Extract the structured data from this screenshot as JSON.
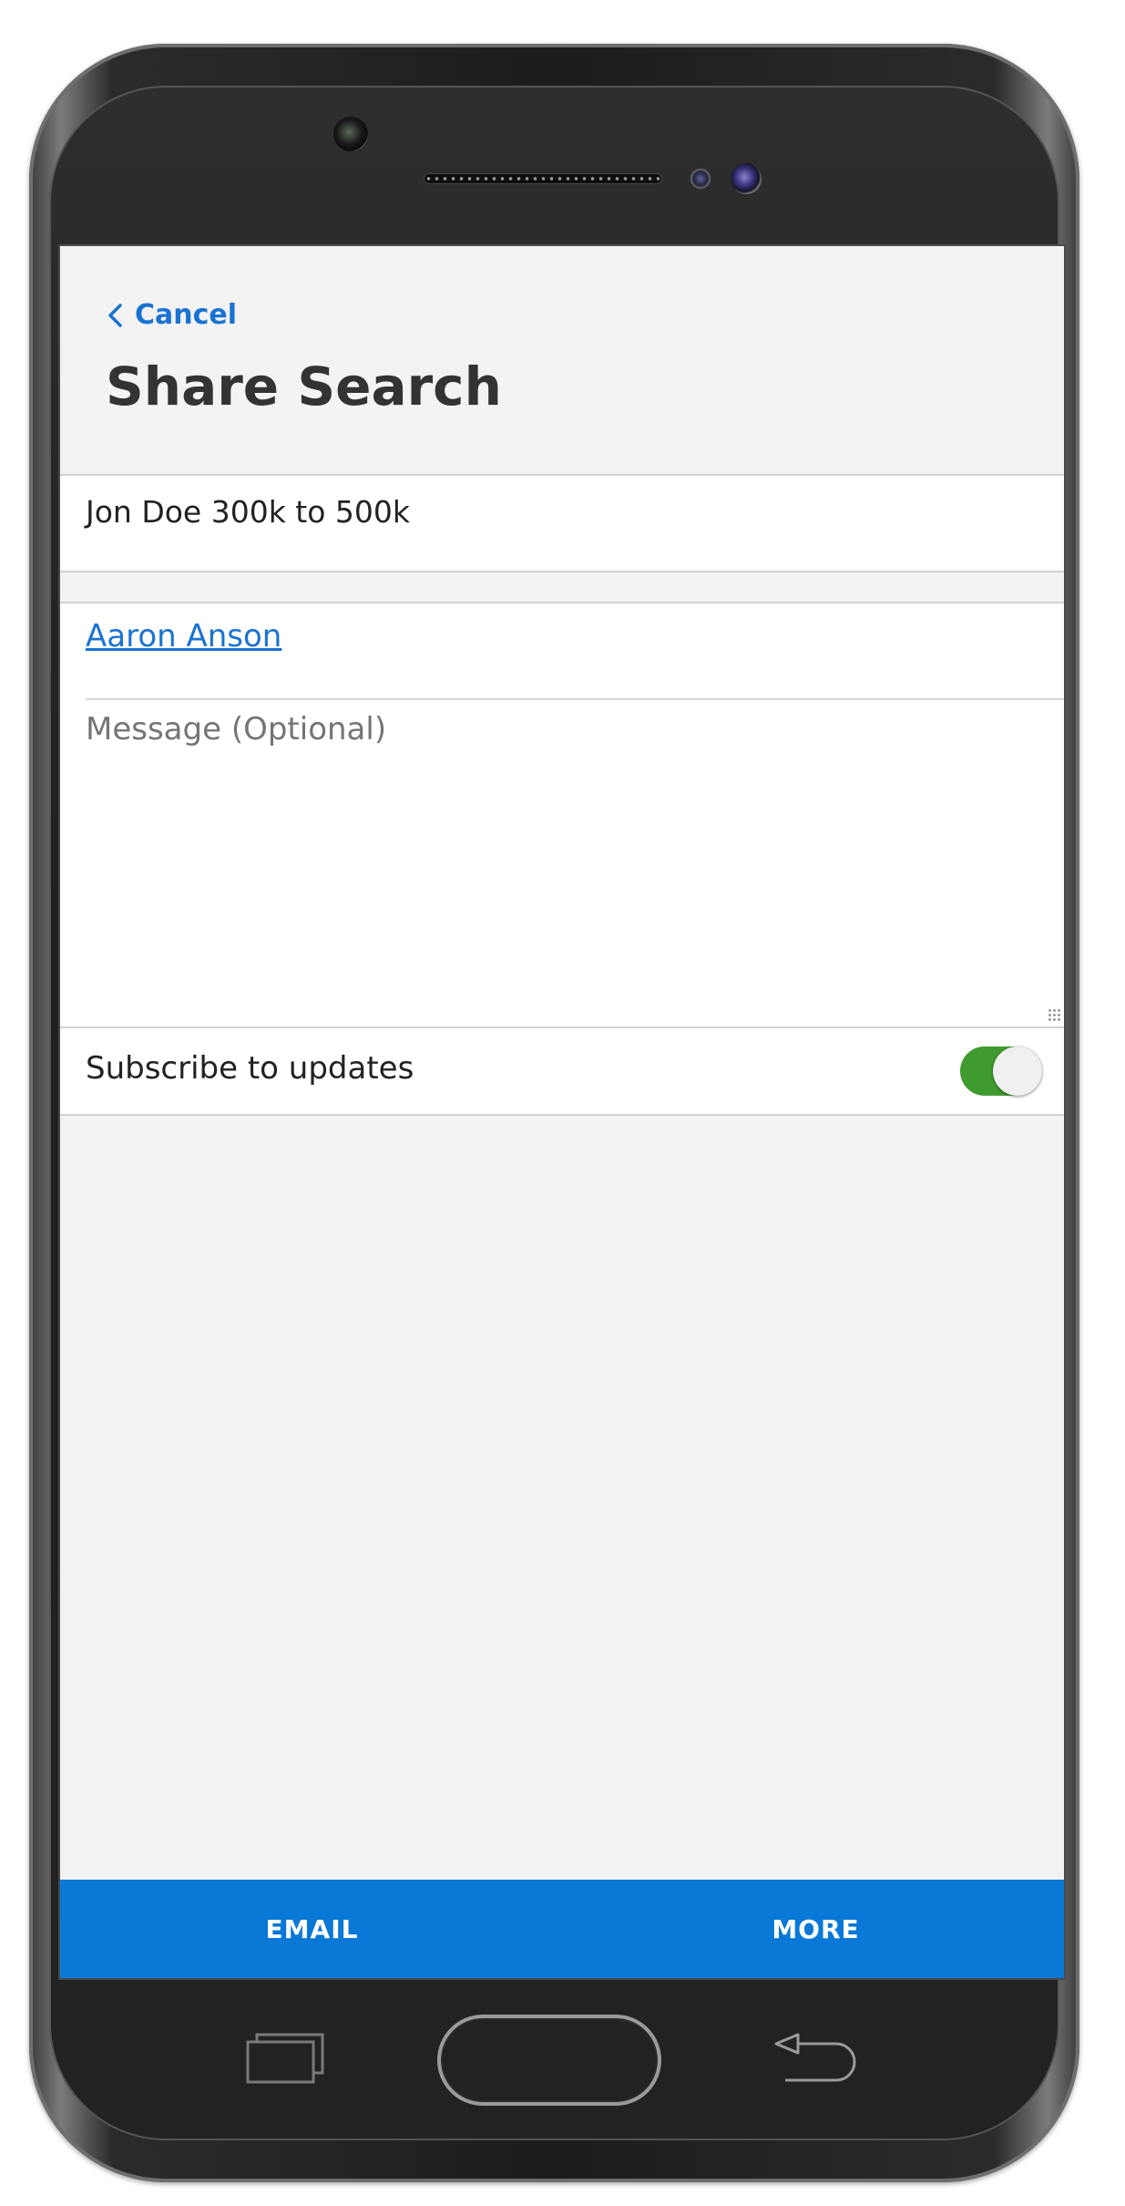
{
  "header": {
    "cancel_label": "Cancel",
    "title": "Share Search"
  },
  "search": {
    "name": "Jon Doe 300k to 500k"
  },
  "recipient": {
    "name": "Aaron Anson"
  },
  "message": {
    "placeholder": "Message (Optional)",
    "value": ""
  },
  "subscribe": {
    "label": "Subscribe to updates",
    "enabled": true
  },
  "actions": {
    "email_label": "EMAIL",
    "more_label": "MORE"
  },
  "colors": {
    "accent": "#0a78d6",
    "link": "#1a73d2",
    "toggle_on": "#3f9b2f"
  },
  "icons": {
    "cancel": "chevron-left-icon",
    "recent_apps": "recent-apps-icon",
    "home": "home-button",
    "back": "back-arrow-icon"
  }
}
